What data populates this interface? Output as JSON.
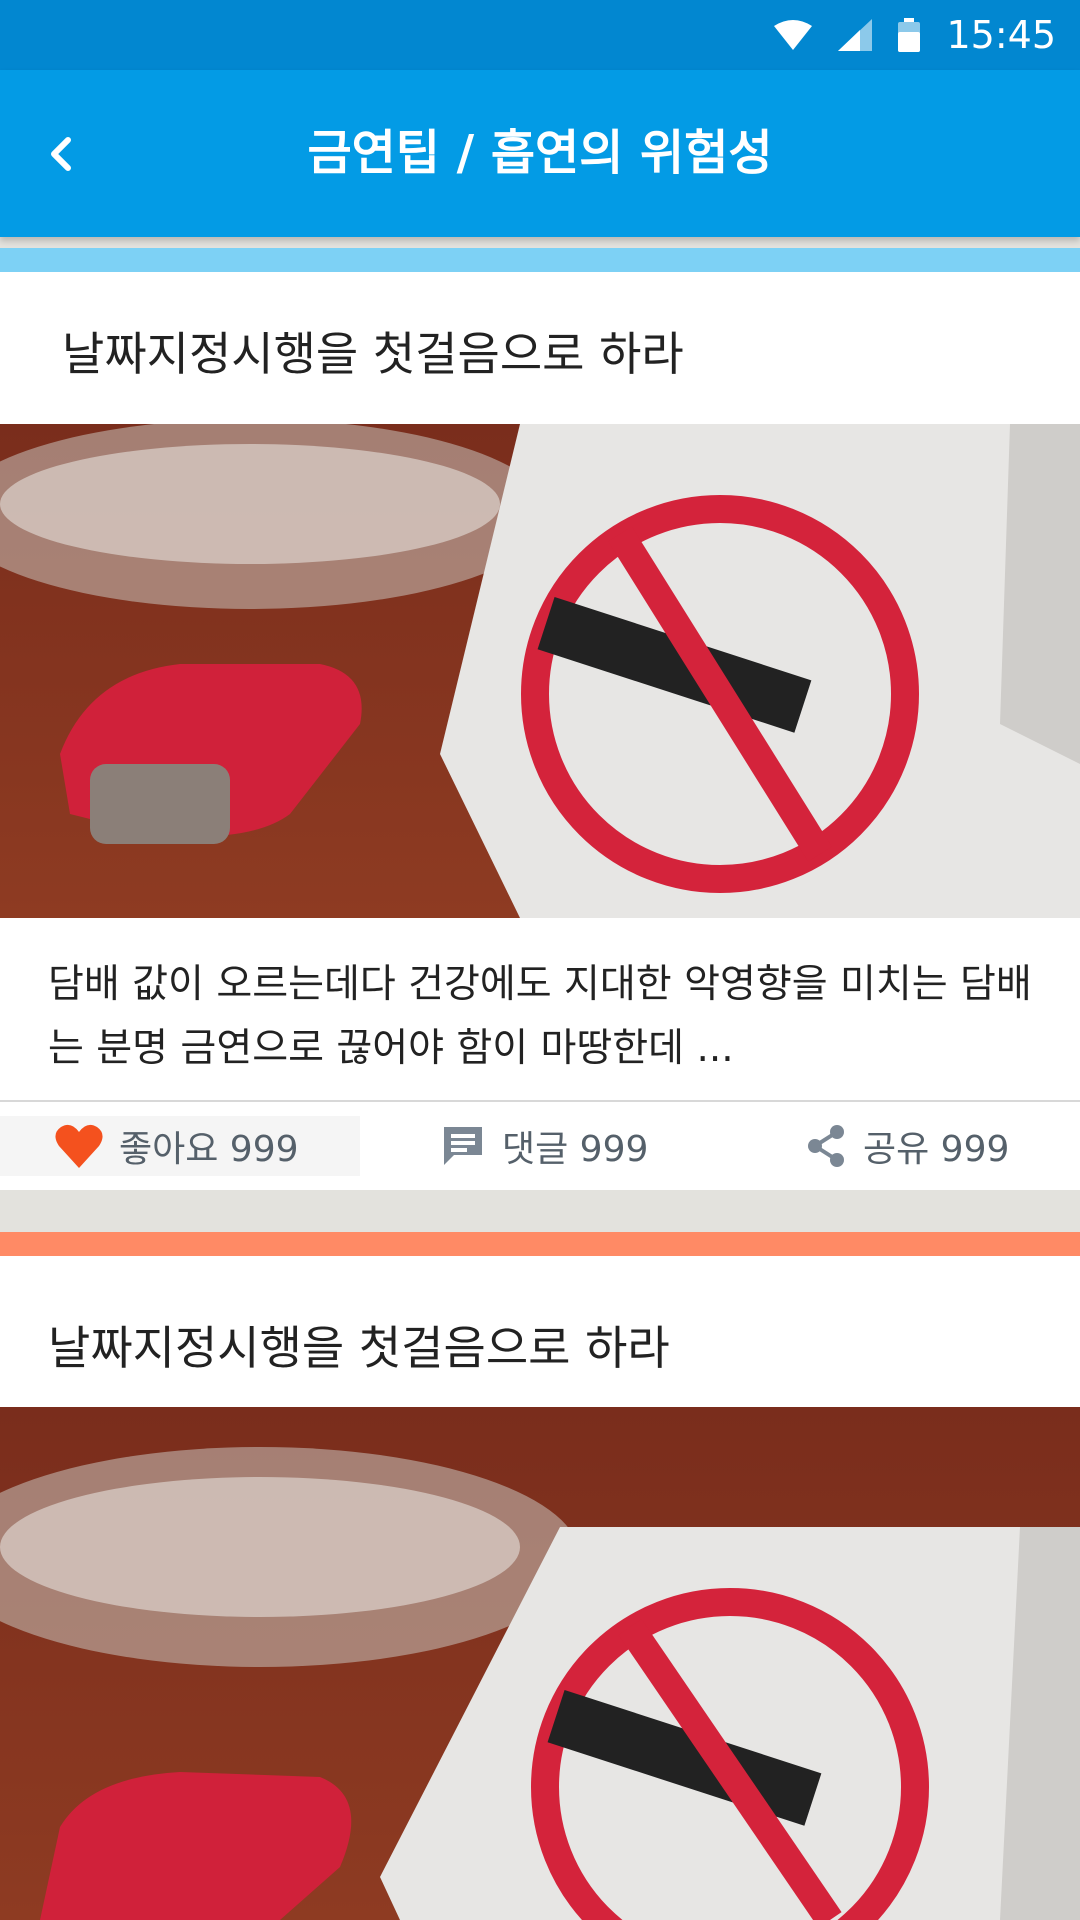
{
  "status_bar": {
    "time": "15:45"
  },
  "app_bar": {
    "title": "금연팁 / 흡연의 위험성"
  },
  "cards": [
    {
      "title": "날짜지정시행을 첫걸음으로 하라",
      "excerpt": "담배 값이 오르는데다 건강에도 지대한 악영향을 미치는 담배는 분명 금연으로 끊어야 함이 마땅한데 ...",
      "like_label": "좋아요 999",
      "comment_label": "댓글 999",
      "share_label": "공유 999",
      "accent_color": "#7dd1f5"
    },
    {
      "title": "날짜지정시행을 첫걸음으로 하라",
      "accent_color": "#ff8a65"
    }
  ],
  "colors": {
    "status_bar": "#0287d0",
    "app_bar": "#039be5",
    "heart": "#f4511e"
  }
}
